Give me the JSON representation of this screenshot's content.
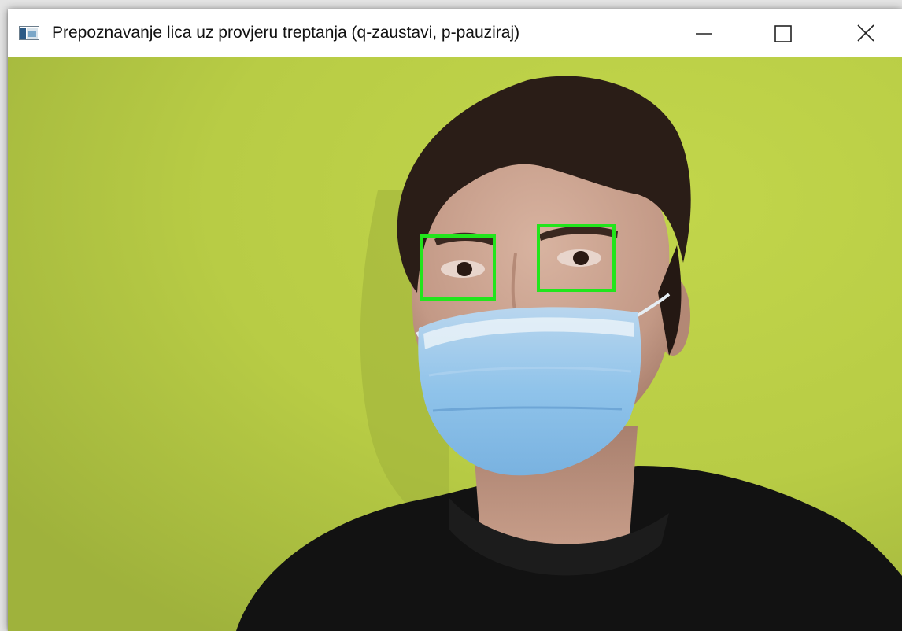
{
  "window": {
    "title": "Prepoznavanje lica uz provjeru treptanja (q-zaustavi, p-pauziraj)",
    "controls": {
      "minimize_icon": "minimize-icon",
      "maximize_icon": "maximize-icon",
      "close_icon": "close-icon"
    }
  },
  "video_feed": {
    "detections": [
      {
        "label": "eye",
        "color": "#22e51c"
      },
      {
        "label": "eye",
        "color": "#22e51c"
      }
    ]
  },
  "colors": {
    "wall": "#b9cf45",
    "detection_box": "#22e51c",
    "titlebar": "#ffffff"
  }
}
